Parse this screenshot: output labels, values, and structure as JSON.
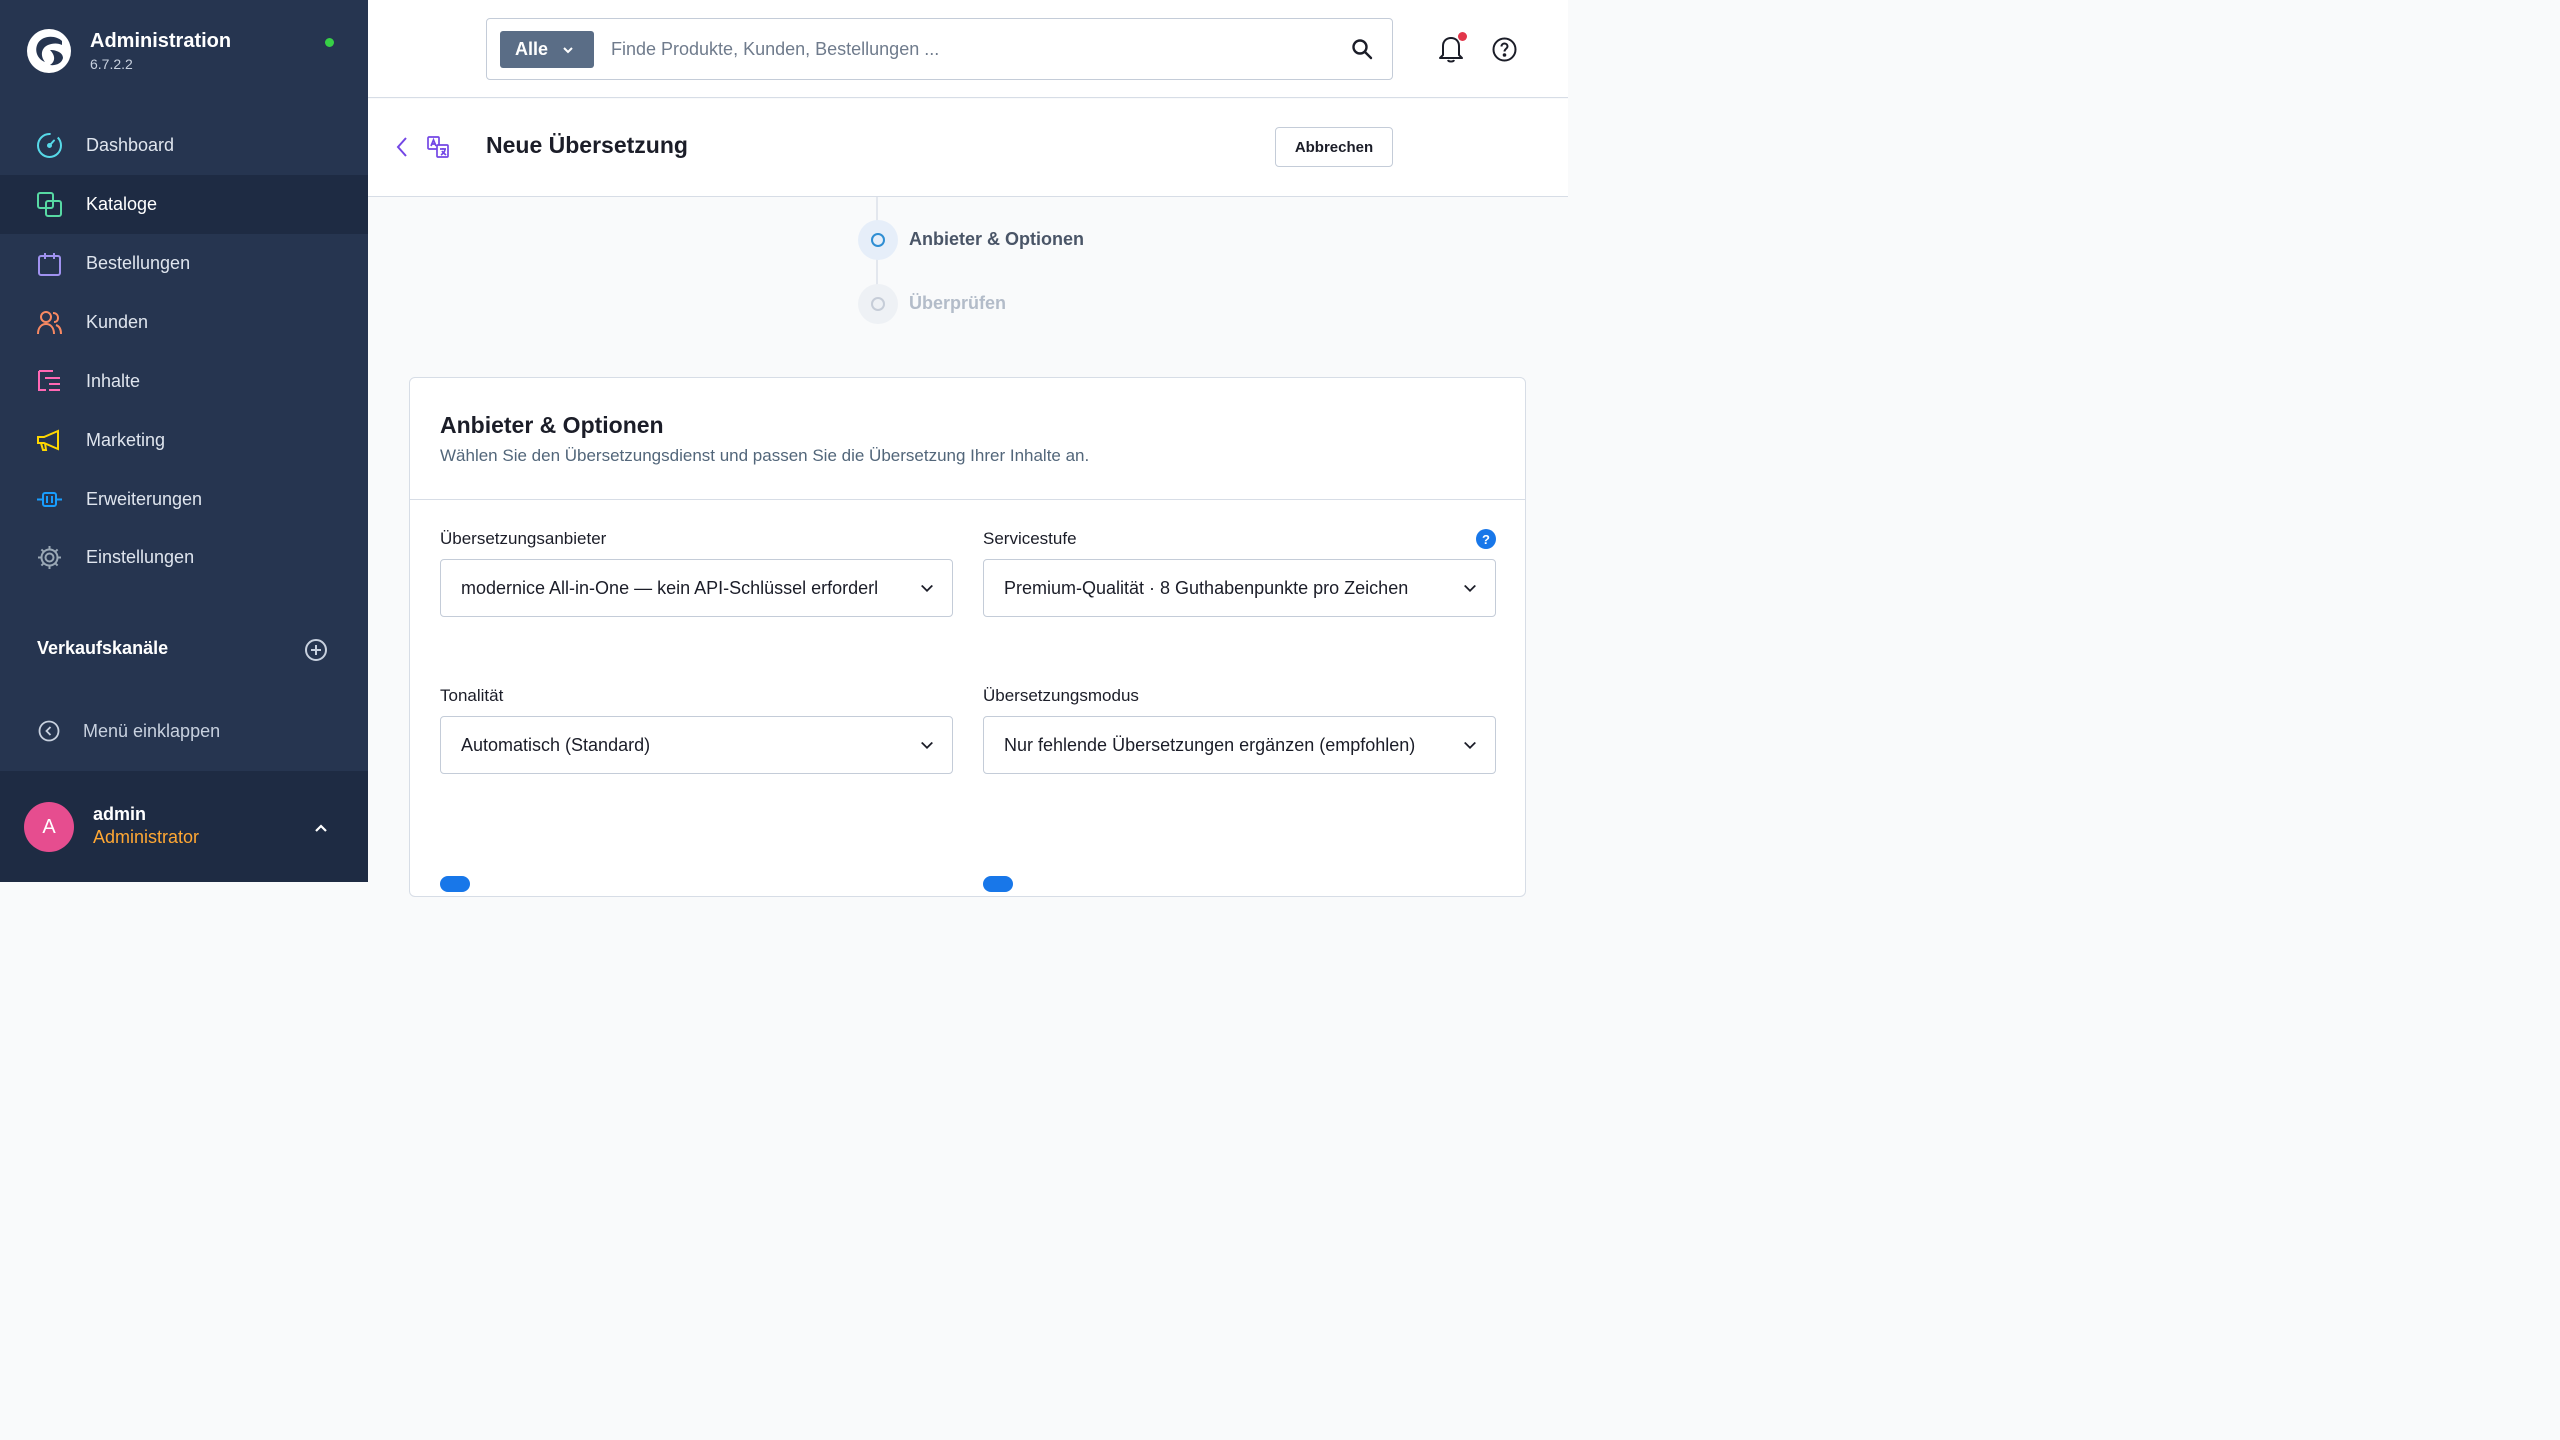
{
  "app": {
    "title": "Administration",
    "version": "6.7.2.2",
    "status_color": "#37d046",
    "logo_icon": "shopware-logo-icon"
  },
  "sidebar": {
    "items": [
      {
        "label": "Dashboard",
        "icon": "dashboard-gauge-icon",
        "color": "#57d9e8",
        "active": false
      },
      {
        "label": "Kataloge",
        "icon": "catalogue-icon",
        "color": "#57d9a3",
        "active": true
      },
      {
        "label": "Bestellungen",
        "icon": "shopping-bag-icon",
        "color": "#a092f0",
        "active": false
      },
      {
        "label": "Kunden",
        "icon": "customers-icon",
        "color": "#f88962",
        "active": false
      },
      {
        "label": "Inhalte",
        "icon": "content-icon",
        "color": "#ff68b4",
        "active": false
      },
      {
        "label": "Marketing",
        "icon": "megaphone-icon",
        "color": "#ffd700",
        "active": false
      },
      {
        "label": "Erweiterungen",
        "icon": "plug-icon",
        "color": "#189eff",
        "active": false
      },
      {
        "label": "Einstellungen",
        "icon": "gear-icon",
        "color": "#9aa8b5",
        "active": false
      }
    ],
    "sales_channels_title": "Verkaufskanäle",
    "collapse_label": "Menü einklappen"
  },
  "user": {
    "initial": "A",
    "name": "admin",
    "role": "Administrator",
    "avatar_color": "#e64d8f"
  },
  "topbar": {
    "search_type": "Alle",
    "search_placeholder": "Finde Produkte, Kunden, Bestellungen ...",
    "search_value": "",
    "notification_dot_color": "#e2364a"
  },
  "header": {
    "title": "Neue Übersetzung",
    "cancel_label": "Abbrechen"
  },
  "steps": [
    {
      "label": "Anbieter & Optionen",
      "active": true
    },
    {
      "label": "Überprüfen",
      "active": false
    }
  ],
  "card": {
    "title": "Anbieter & Optionen",
    "subtitle": "Wählen Sie den Übersetzungsdienst und passen Sie die Übersetzung Ihrer Inhalte an.",
    "fields": {
      "provider": {
        "label": "Übersetzungsanbieter",
        "value": "modernice All-in-One — kein API-Schlüssel erforderl"
      },
      "service_level": {
        "label": "Servicestufe",
        "value": "Premium-Qualität · 8 Guthabenpunkte pro Zeichen",
        "help": "?"
      },
      "tone": {
        "label": "Tonalität",
        "value": "Automatisch (Standard)"
      },
      "mode": {
        "label": "Übersetzungsmodus",
        "value": "Nur fehlende Übersetzungen ergänzen (empfohlen)"
      }
    }
  },
  "colors": {
    "sidebar_bg": "#263550",
    "sidebar_active_bg": "#1e2b43",
    "accent_blue": "#1877e9",
    "user_role": "#ffa733"
  }
}
